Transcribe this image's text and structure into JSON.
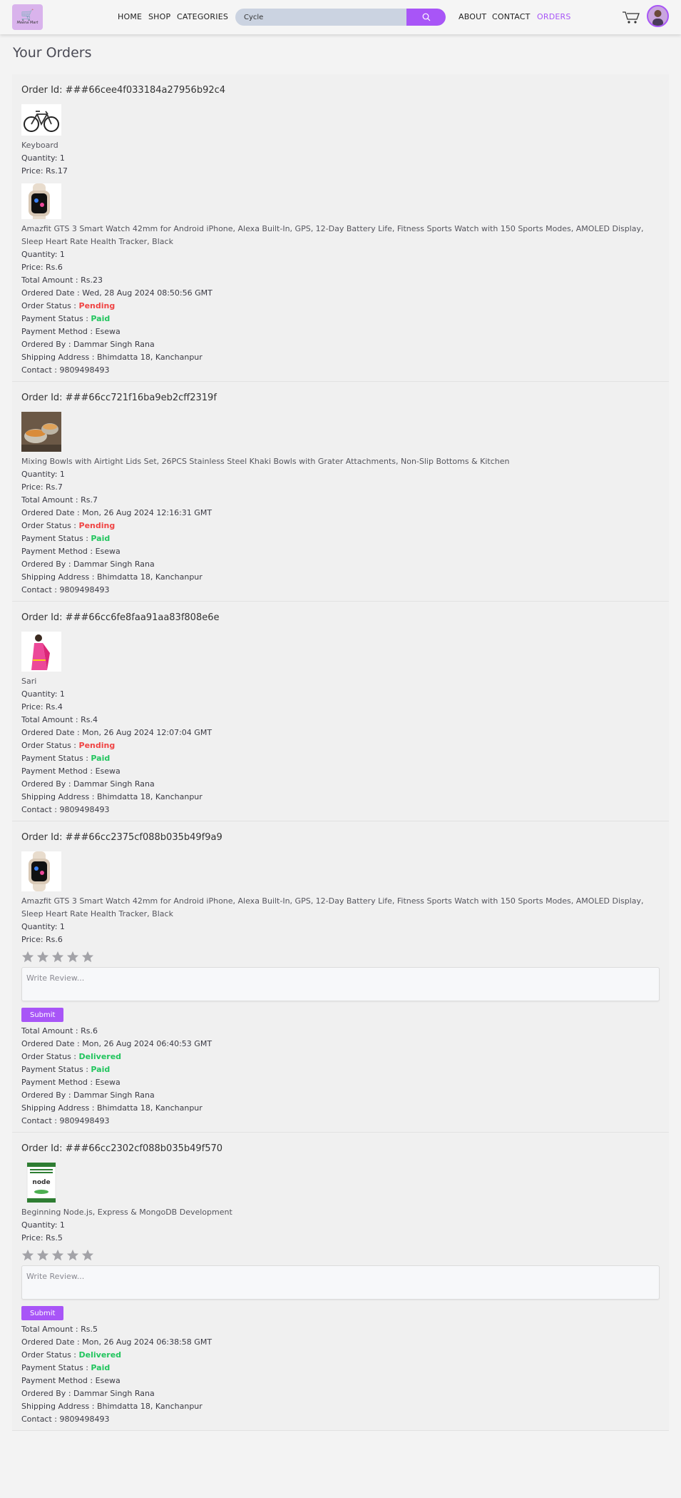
{
  "brand": {
    "logo_text": "Meena Mart"
  },
  "nav": {
    "home": "HOME",
    "shop": "SHOP",
    "categories": "CATEGORIES",
    "about": "ABOUT",
    "contact": "CONTACT",
    "orders": "ORDERS"
  },
  "search": {
    "value": "Cycle",
    "icon": "search-icon"
  },
  "header_icons": {
    "cart": "cart-icon",
    "avatar": "avatar"
  },
  "colors": {
    "accent": "#a855f7",
    "pending": "#ef4444",
    "paid": "#22c55e"
  },
  "page_title": "Your Orders",
  "labels": {
    "quantity": "Quantity : ",
    "price": "Price: ",
    "total": "Total Amount : ",
    "ordered_date": "Ordered Date : ",
    "order_status": "Order Status : ",
    "payment_status": "Payment Status : ",
    "payment_method": "Payment Method : ",
    "ordered_by": "Ordered By : ",
    "shipping": "Shipping Address : ",
    "contact": "Contact : ",
    "review_placeholder": "Write Review...",
    "submit": "Submit"
  },
  "orders": [
    {
      "id": "Order Id: ###66cee4f033184a27956b92c4",
      "items": [
        {
          "image": "bicycle",
          "name": "Keyboard",
          "quantity": "Quantity: 1",
          "price": "Price: Rs.17"
        },
        {
          "image": "smartwatch",
          "name": "Amazfit GTS 3 Smart Watch 42mm for Android iPhone, Alexa Built-In, GPS, 12-Day Battery Life, Fitness Sports Watch with 150 Sports Modes, AMOLED Display, Sleep Heart Rate Health Tracker, Black",
          "quantity": "Quantity: 1",
          "price": "Price: Rs.6"
        }
      ],
      "total": "Total Amount : Rs.23",
      "ordered_date": "Ordered Date : Wed, 28 Aug 2024 08:50:56 GMT",
      "order_status_label": "Order Status : ",
      "order_status": "Pending",
      "payment_status_label": "Payment Status : ",
      "payment_status": "Paid",
      "payment_method": "Payment Method : Esewa",
      "ordered_by": "Ordered By : Dammar Singh Rana",
      "shipping": "Shipping Address : Bhimdatta 18, Kanchanpur",
      "contact": "Contact : 9809498493"
    },
    {
      "id": "Order Id: ###66cc721f16ba9eb2cff2319f",
      "items": [
        {
          "image": "bowls",
          "name": "Mixing Bowls with Airtight Lids Set, 26PCS Stainless Steel Khaki Bowls with Grater Attachments, Non-Slip Bottoms & Kitchen",
          "quantity": "Quantity: 1",
          "price": "Price: Rs.7"
        }
      ],
      "total": "Total Amount : Rs.7",
      "ordered_date": "Ordered Date : Mon, 26 Aug 2024 12:16:31 GMT",
      "order_status_label": "Order Status : ",
      "order_status": "Pending",
      "payment_status_label": "Payment Status : ",
      "payment_status": "Paid",
      "payment_method": "Payment Method : Esewa",
      "ordered_by": "Ordered By : Dammar Singh Rana",
      "shipping": "Shipping Address : Bhimdatta 18, Kanchanpur",
      "contact": "Contact : 9809498493"
    },
    {
      "id": "Order Id: ###66cc6fe8faa91aa83f808e6e",
      "items": [
        {
          "image": "sari",
          "name": "Sari",
          "quantity": "Quantity: 1",
          "price": "Price: Rs.4"
        }
      ],
      "total": "Total Amount : Rs.4",
      "ordered_date": "Ordered Date : Mon, 26 Aug 2024 12:07:04 GMT",
      "order_status_label": "Order Status : ",
      "order_status": "Pending",
      "payment_status_label": "Payment Status : ",
      "payment_status": "Paid",
      "payment_method": "Payment Method : Esewa",
      "ordered_by": "Ordered By : Dammar Singh Rana",
      "shipping": "Shipping Address : Bhimdatta 18, Kanchanpur",
      "contact": "Contact : 9809498493"
    },
    {
      "id": "Order Id: ###66cc2375cf088b035b49f9a9",
      "items": [
        {
          "image": "smartwatch",
          "name": "Amazfit GTS 3 Smart Watch 42mm for Android iPhone, Alexa Built-In, GPS, 12-Day Battery Life, Fitness Sports Watch with 150 Sports Modes, AMOLED Display, Sleep Heart Rate Health Tracker, Black",
          "quantity": "Quantity: 1",
          "price": "Price: Rs.6",
          "rating": 0
        }
      ],
      "total": "Total Amount : Rs.6",
      "ordered_date": "Ordered Date : Mon, 26 Aug 2024 06:40:53 GMT",
      "order_status_label": "Order Status : ",
      "order_status": "Delivered",
      "payment_status_label": "Payment Status : ",
      "payment_status": "Paid",
      "payment_method": "Payment Method : Esewa",
      "ordered_by": "Ordered By : Dammar Singh Rana",
      "shipping": "Shipping Address : Bhimdatta 18, Kanchanpur",
      "contact": "Contact : 9809498493"
    },
    {
      "id": "Order Id: ###66cc2302cf088b035b49f570",
      "items": [
        {
          "image": "book",
          "book_cover_text": "node",
          "name": "Beginning Node.js, Express & MongoDB Development",
          "quantity": "Quantity: 1",
          "price": "Price: Rs.5",
          "rating": 0
        }
      ],
      "total": "Total Amount : Rs.5",
      "ordered_date": "Ordered Date : Mon, 26 Aug 2024 06:38:58 GMT",
      "order_status_label": "Order Status : ",
      "order_status": "Delivered",
      "payment_status_label": "Payment Status : ",
      "payment_status": "Paid",
      "payment_method": "Payment Method : Esewa",
      "ordered_by": "Ordered By : Dammar Singh Rana",
      "shipping": "Shipping Address : Bhimdatta 18, Kanchanpur",
      "contact": "Contact : 9809498493"
    }
  ]
}
